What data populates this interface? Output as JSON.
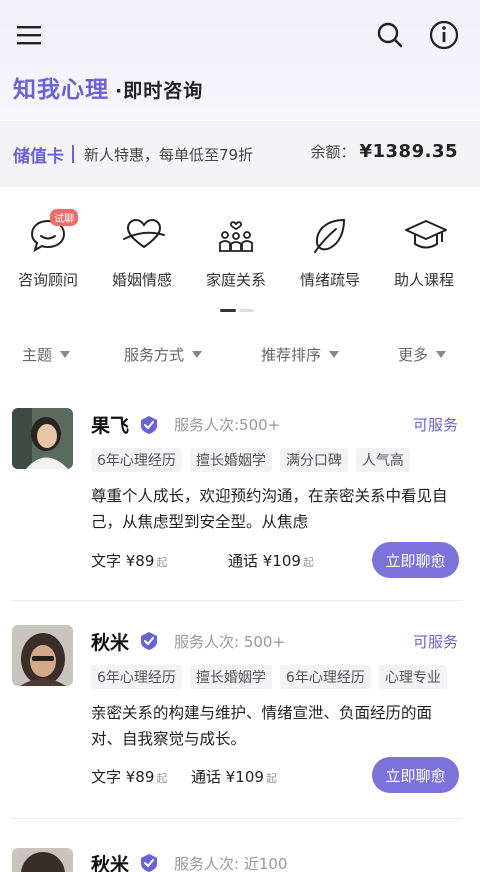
{
  "header": {
    "brand_name": "知我心理",
    "brand_sub": "·即时咨询"
  },
  "stored_card": {
    "title": "储值卡",
    "promo": "新人特惠，每单低至79折",
    "balance_label": "余额：",
    "balance_value": "¥1389.35"
  },
  "categories": [
    {
      "label": "咨询顾问",
      "icon": "chat-bubble-icon",
      "badge": "试聊"
    },
    {
      "label": "婚姻情感",
      "icon": "heart-icon"
    },
    {
      "label": "家庭关系",
      "icon": "family-icon"
    },
    {
      "label": "情绪疏导",
      "icon": "leaf-icon"
    },
    {
      "label": "助人课程",
      "icon": "graduation-cap-icon"
    }
  ],
  "filters": [
    "主题",
    "服务方式",
    "推荐排序",
    "更多"
  ],
  "counselors": [
    {
      "name": "果飞",
      "served": "服务人次:500+",
      "status": "可服务",
      "tags": [
        "6年心理经历",
        "擅长婚姻学",
        "满分口碑",
        "人气高"
      ],
      "bio": "尊重个人成长，欢迎预约沟通，在亲密关系中看见自己，从焦虑型到安全型。从焦虑",
      "text_price": "文字 ¥89",
      "call_price": "通话 ¥109",
      "unit": "起",
      "cta": "立即聊愈"
    },
    {
      "name": "秋米",
      "served": "服务人次: 500+",
      "status": "可服务",
      "tags": [
        "6年心理经历",
        "擅长婚姻学",
        "6年心理经历",
        "心理专业"
      ],
      "bio": "亲密关系的构建与维护、情绪宣泄、负面经历的面对、自我察觉与成长。",
      "text_price": "文字 ¥89",
      "call_price": "通话 ¥109",
      "unit": "起",
      "cta": "立即聊愈"
    },
    {
      "name": "秋米",
      "served": "服务人次: 近100"
    }
  ],
  "colors": {
    "accent": "#6a63d6",
    "button": "#7b73d9",
    "badge": "#f06b6b"
  }
}
